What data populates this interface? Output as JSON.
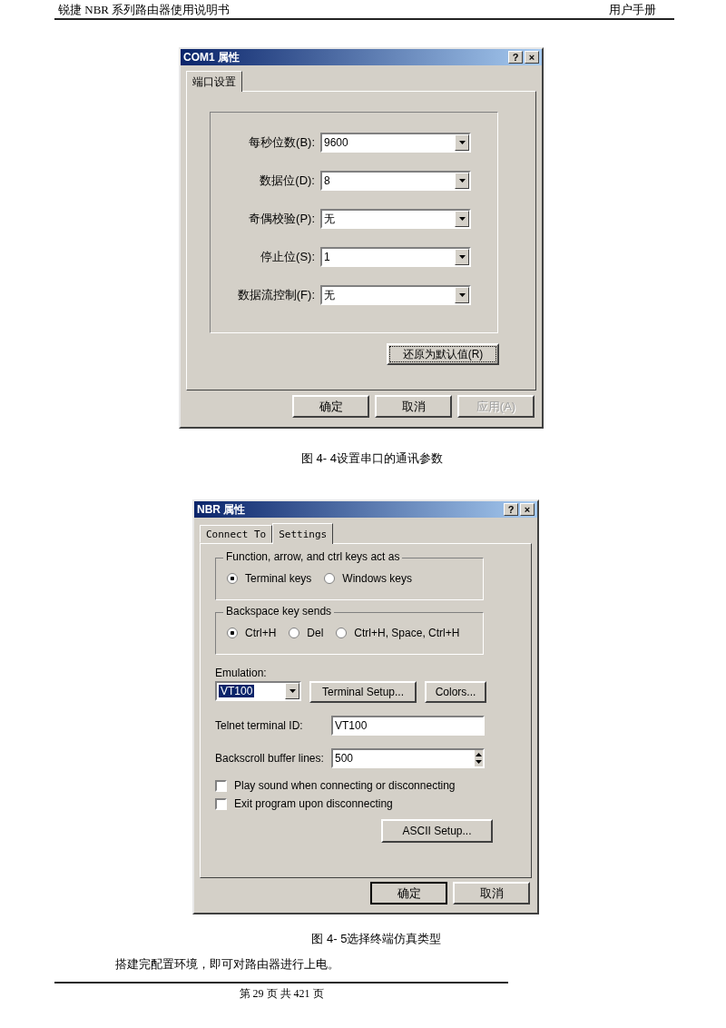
{
  "header": {
    "left": "锐捷 NBR 系列路由器使用说明书",
    "right": "用户手册"
  },
  "com1_dialog": {
    "title": "COM1 属性",
    "help": "?",
    "close": "×",
    "tabs": [
      {
        "label": "端口设置",
        "selected": true
      }
    ],
    "fields": [
      {
        "label": "每秒位数(B):",
        "value": "9600"
      },
      {
        "label": "数据位(D):",
        "value": "8"
      },
      {
        "label": "奇偶校验(P):",
        "value": "无"
      },
      {
        "label": "停止位(S):",
        "value": "1"
      },
      {
        "label": "数据流控制(F):",
        "value": "无"
      }
    ],
    "restore_button": "还原为默认值(R)",
    "buttons": [
      {
        "label": "确定",
        "disabled": false
      },
      {
        "label": "取消",
        "disabled": false
      },
      {
        "label": "应用(A)",
        "disabled": true
      }
    ]
  },
  "caption_1": "图 4- 4设置串口的通讯参数",
  "nbr_dialog": {
    "title": "NBR 属性",
    "help": "?",
    "close": "×",
    "tabs": [
      {
        "label": "Connect To",
        "selected": false
      },
      {
        "label": "Settings",
        "selected": true
      }
    ],
    "groups": [
      {
        "legend": "Function, arrow, and ctrl keys act as",
        "options": [
          {
            "label": "Terminal keys",
            "selected": true
          },
          {
            "label": "Windows keys",
            "selected": false
          }
        ]
      },
      {
        "legend": "Backspace key sends",
        "options": [
          {
            "label": "Ctrl+H",
            "selected": true
          },
          {
            "label": "Del",
            "selected": false
          },
          {
            "label": "Ctrl+H, Space, Ctrl+H",
            "selected": false
          }
        ]
      }
    ],
    "emulation": {
      "label": "Emulation:",
      "value": "VT100"
    },
    "terminal_setup": "Terminal Setup...",
    "colors": "Colors...",
    "telnet": {
      "label": "Telnet terminal ID:",
      "value": "VT100"
    },
    "backscroll": {
      "label": "Backscroll buffer lines:",
      "value": "500"
    },
    "checkboxes": [
      {
        "label": "Play sound when connecting or disconnecting",
        "checked": false
      },
      {
        "label": "Exit program upon disconnecting",
        "checked": false
      }
    ],
    "ascii_button": "ASCII Setup...",
    "buttons": [
      {
        "label": "确定",
        "disabled": false
      },
      {
        "label": "取消",
        "disabled": false
      }
    ]
  },
  "caption_2": "图 4- 5选择终端仿真类型",
  "paragraph": "搭建完配置环境，即可对路由器进行上电。",
  "footer": "第 29 页 共 421 页"
}
